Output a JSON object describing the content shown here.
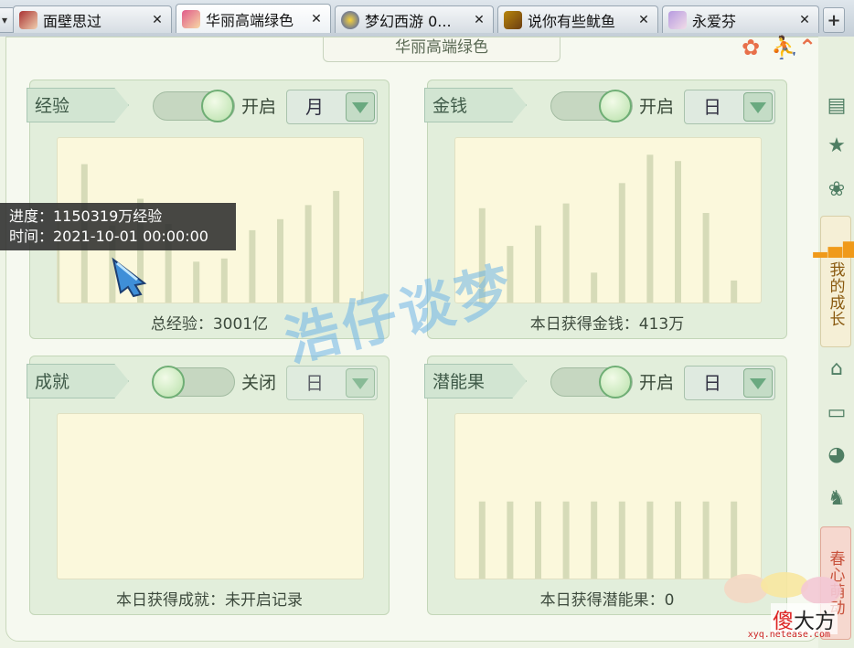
{
  "tabs": [
    {
      "label": "面壁思过",
      "favicon": "avatar-red-hair-icon",
      "active": false
    },
    {
      "label": "华丽高端绿色",
      "favicon": "avatar-pink-hair-icon",
      "active": true
    },
    {
      "label": "梦幻西游 0...",
      "favicon": "game-shield-icon",
      "active": false
    },
    {
      "label": "说你有些鱿鱼",
      "favicon": "avatar-gold-mask-icon",
      "active": false
    },
    {
      "label": "永爱芬",
      "favicon": "avatar-purple-hair-icon",
      "active": false
    }
  ],
  "new_tab_label": "+",
  "close_label": "✕",
  "panel": {
    "title": "华丽高端绿色"
  },
  "cards": {
    "experience": {
      "label": "经验",
      "toggle_text": "开启",
      "toggle_on": true,
      "period": "月",
      "footer": "总经验：3001亿"
    },
    "money": {
      "label": "金钱",
      "toggle_text": "开启",
      "toggle_on": true,
      "period": "日",
      "footer": "本日获得金钱：413万"
    },
    "achievement": {
      "label": "成就",
      "toggle_text": "关闭",
      "toggle_on": false,
      "period": "日",
      "footer": "本日获得成就：未开启记录"
    },
    "potential": {
      "label": "潜能果",
      "toggle_text": "开启",
      "toggle_on": true,
      "period": "日",
      "footer": "本日获得潜能果：0"
    }
  },
  "chart_data": [
    {
      "type": "bar",
      "title": "经验",
      "values": [
        60,
        88,
        49,
        66,
        50,
        26,
        28,
        46,
        53,
        62,
        71,
        7
      ],
      "ylim": [
        0,
        100
      ]
    },
    {
      "type": "bar",
      "title": "金钱",
      "values": [
        60,
        36,
        49,
        63,
        19,
        76,
        94,
        90,
        57,
        14
      ],
      "ylim": [
        0,
        100
      ]
    },
    {
      "type": "bar",
      "title": "成就",
      "values": [],
      "ylim": [
        0,
        100
      ]
    },
    {
      "type": "bar",
      "title": "潜能果",
      "values": [
        49,
        49,
        49,
        49,
        49,
        49,
        49,
        49,
        49,
        49
      ],
      "ylim": [
        0,
        100
      ]
    }
  ],
  "tooltip": {
    "progress": "进度：1150319万经验",
    "time": "时间：2021-10-01 00:00:00"
  },
  "watermark": "浩仔谈梦",
  "sidebar": {
    "growth_tab": "我的成长",
    "event_tab": "春心萌动"
  },
  "brand": {
    "first_char": "傻",
    "rest": "大方",
    "url": "xyq.netease.com"
  },
  "colors": {
    "bar": "#d6dbb8",
    "chart_bg": "#fbf8dc",
    "card_bg": "#e2eedb",
    "accent_green": "#6fae75"
  }
}
